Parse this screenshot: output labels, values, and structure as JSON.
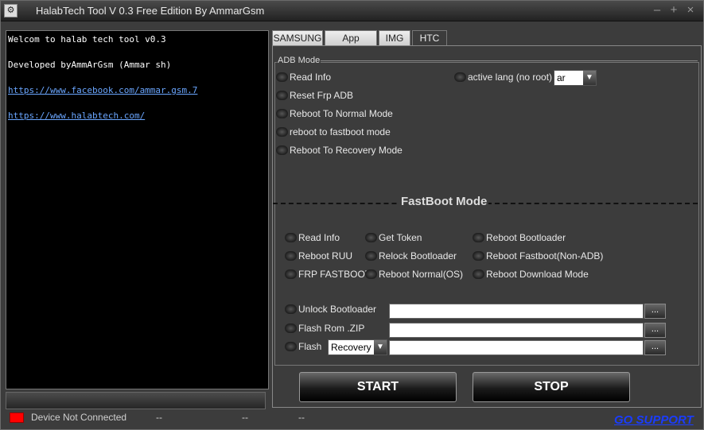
{
  "window": {
    "title": "HalabTech Tool V 0.3 Free Edition By AmmarGsm",
    "app_icon": "app-icon",
    "minimize": "–",
    "maximize": "+",
    "close": "×"
  },
  "console": {
    "line1": "Welcom to halab tech tool v0.3",
    "line2": "Developed byAmmArGsm (Ammar sh)",
    "link1": "https://www.facebook.com/ammar.gsm.7",
    "link2": "https://www.halabtech.com/"
  },
  "tabs": [
    "SAMSUNG",
    "App manger",
    "IMG",
    "HTC"
  ],
  "adb": {
    "legend": "ADB Mode",
    "options": [
      "Read Info",
      "Reset Frp ADB",
      "Reboot To Normal Mode",
      "reboot to fastboot mode",
      "Reboot To Recovery Mode"
    ],
    "lang_label": "active lang (no root)",
    "lang_value": "ar"
  },
  "fastboot": {
    "title": "FastBoot Mode",
    "col1": [
      "Read Info",
      "Reboot RUU",
      "FRP FASTBOOT"
    ],
    "col2": [
      "Get Token",
      "Relock Bootloader",
      "Reboot Normal(OS)"
    ],
    "col3": [
      "Reboot Bootloader",
      "Reboot Fastboot(Non-ADB)",
      "Reboot Download Mode"
    ],
    "unlock": "Unlock Bootloader",
    "flash_rom": "Flash Rom .ZIP",
    "flash": "Flash",
    "flash_target": "Recovery",
    "browse": "..."
  },
  "actions": {
    "start": "START",
    "stop": "STOP"
  },
  "status": {
    "device": "Device Not Connected",
    "s1": "--",
    "s2": "--",
    "s3": "--",
    "support": "GO SUPPORT",
    "led_color": "#ff0000"
  }
}
